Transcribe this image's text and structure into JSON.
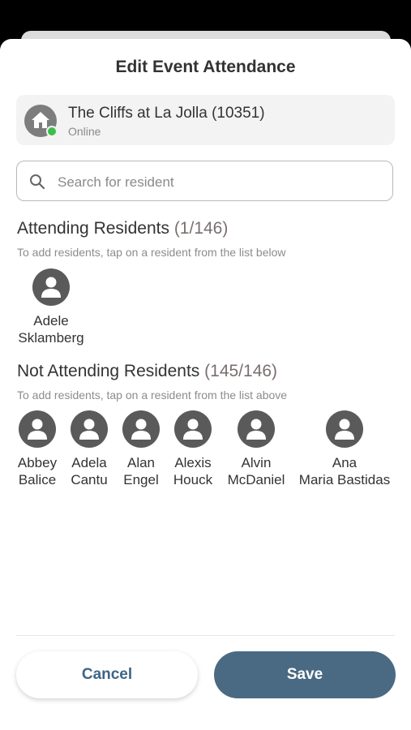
{
  "title": "Edit Event Attendance",
  "community": {
    "name": "The Cliffs at La Jolla (10351)",
    "status": "Online"
  },
  "search": {
    "placeholder": "Search for resident"
  },
  "attending": {
    "heading": "Attending Residents",
    "count": "(1/146)",
    "hint": "To add residents, tap on a resident from the list below",
    "residents": [
      {
        "first": "Adele",
        "last": "Sklamberg"
      }
    ]
  },
  "not_attending": {
    "heading": "Not Attending Residents",
    "count": "(145/146)",
    "hint": "To add residents, tap on a resident from the list above",
    "residents": [
      {
        "first": "Abbey",
        "last": "Balice"
      },
      {
        "first": "Adela",
        "last": "Cantu"
      },
      {
        "first": "Alan",
        "last": "Engel"
      },
      {
        "first": "Alexis",
        "last": "Houck"
      },
      {
        "first": "Alvin",
        "last": "McDaniel"
      },
      {
        "first": "Ana",
        "last": "Maria Bastidas"
      }
    ]
  },
  "buttons": {
    "cancel": "Cancel",
    "save": "Save"
  },
  "colors": {
    "accent": "#4a6a83",
    "online": "#3bbf4a",
    "avatar": "#5a5a5a"
  }
}
